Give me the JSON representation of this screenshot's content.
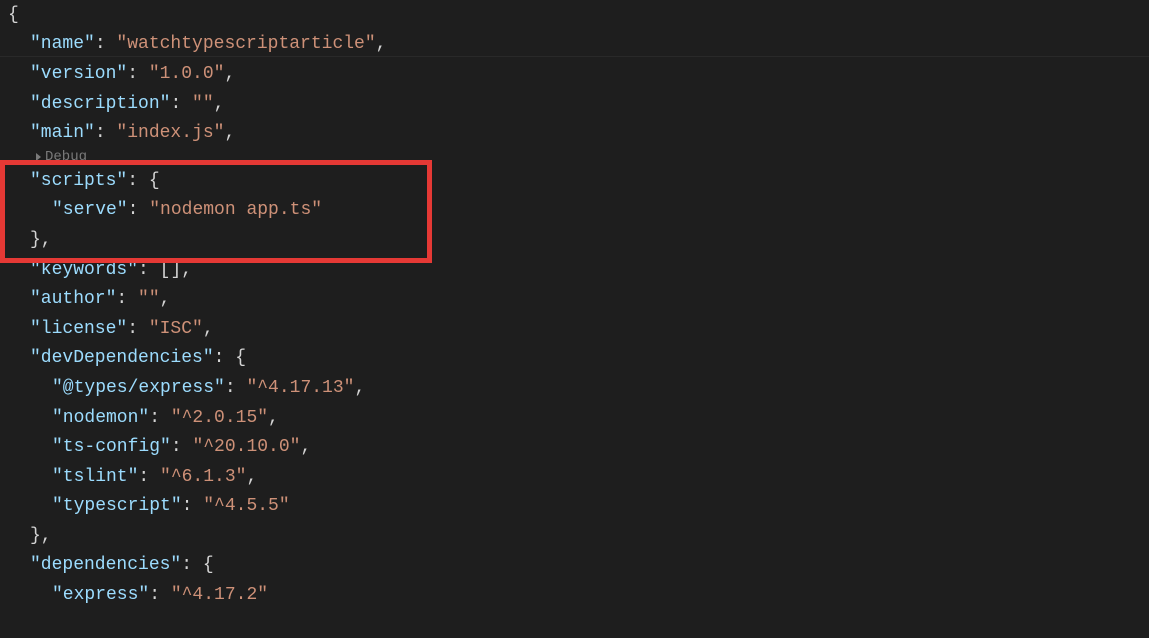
{
  "code": {
    "open_brace": "{",
    "name_key": "\"name\"",
    "name_val": "\"watchtypescriptarticle\"",
    "version_key": "\"version\"",
    "version_val": "\"1.0.0\"",
    "description_key": "\"description\"",
    "description_val": "\"\"",
    "main_key": "\"main\"",
    "main_val": "\"index.js\"",
    "debug_label": "Debug",
    "scripts_key": "\"scripts\"",
    "serve_key": "\"serve\"",
    "serve_val": "\"nodemon app.ts\"",
    "close_brace_comma": "},",
    "keywords_key": "\"keywords\"",
    "keywords_val_open": "[",
    "keywords_val_close": "]",
    "author_key": "\"author\"",
    "author_val": "\"\"",
    "license_key": "\"license\"",
    "license_val": "\"ISC\"",
    "devdeps_key": "\"devDependencies\"",
    "types_express_key": "\"@types/express\"",
    "types_express_val": "\"^4.17.13\"",
    "nodemon_key": "\"nodemon\"",
    "nodemon_val": "\"^2.0.15\"",
    "tsconfig_key": "\"ts-config\"",
    "tsconfig_val": "\"^20.10.0\"",
    "tslint_key": "\"tslint\"",
    "tslint_val": "\"^6.1.3\"",
    "typescript_key": "\"typescript\"",
    "typescript_val": "\"^4.5.5\"",
    "deps_key": "\"dependencies\"",
    "express_key": "\"express\"",
    "express_val": "\"^4.17.2\"",
    "colon_sp": ": ",
    "comma": ",",
    "open_obj": "{",
    "close_obj": "}"
  }
}
